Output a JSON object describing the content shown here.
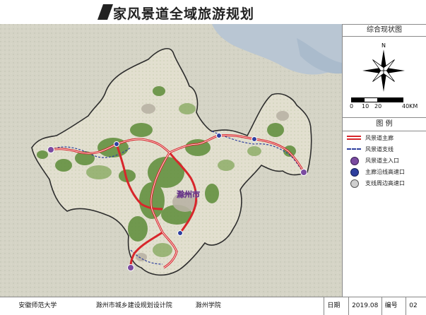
{
  "header": {
    "title": "家风景道全域旅游规划"
  },
  "side": {
    "overview_title": "综合现状图",
    "north_label": "N",
    "scale_ticks": [
      "0",
      "10",
      "20",
      "40KM"
    ],
    "legend_title": "图 例",
    "legend": [
      {
        "label": "风景道主廊",
        "icon": "red-double-line"
      },
      {
        "label": "风景道支线",
        "icon": "blue-dashed-line"
      },
      {
        "label": "风景道主入口",
        "icon": "purple-circle-icon"
      },
      {
        "label": "主廊沿线高速口",
        "icon": "blue-circle-icon"
      },
      {
        "label": "支线周边高速口",
        "icon": "gray-circle-icon"
      }
    ]
  },
  "map": {
    "city_label": "滁州市"
  },
  "footer": {
    "org1": "安徽师范大学",
    "org2": "滁州市城乡建设规划设计院",
    "org3": "滁州学院",
    "date_label": "日期",
    "date_value": "2019.08",
    "num_label": "编号",
    "num_value": "02"
  },
  "colors": {
    "main_route": "#d8262b",
    "branch_route": "#2e3f9e",
    "water": "#b8c8d8",
    "boundary": "#3a3a3a",
    "green": "#5f8f3a"
  }
}
